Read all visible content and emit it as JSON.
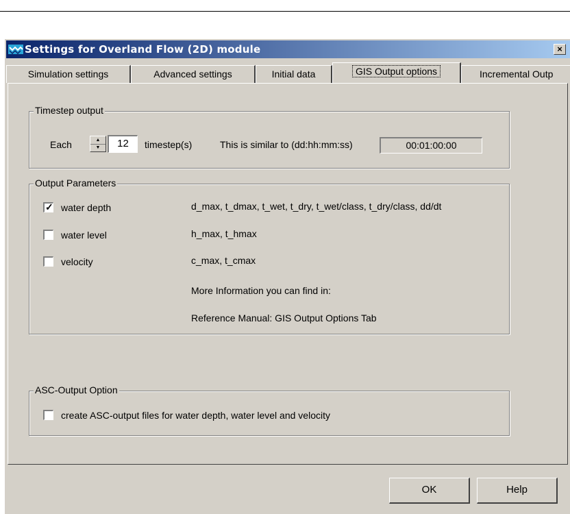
{
  "window": {
    "title": "Settings for Overland Flow (2D) module",
    "close_label": "×"
  },
  "tabs": [
    {
      "label": "Simulation settings"
    },
    {
      "label": "Advanced settings"
    },
    {
      "label": "Initial data"
    },
    {
      "label": "GIS Output options",
      "active": true
    },
    {
      "label": "Incremental Outp"
    }
  ],
  "timestep": {
    "group_title": "Timestep output",
    "each_label": "Each",
    "value": "12",
    "unit_label": "timestep(s)",
    "similar_label": "This is similar to (dd:hh:mm:ss)",
    "similar_value": "00:01:00:00"
  },
  "output_params": {
    "group_title": "Output Parameters",
    "items": [
      {
        "label": "water depth",
        "checked": true,
        "desc": "d_max, t_dmax, t_wet, t_dry, t_wet/class, t_dry/class, dd/dt"
      },
      {
        "label": "water level",
        "checked": false,
        "desc": "h_max, t_hmax"
      },
      {
        "label": "velocity",
        "checked": false,
        "desc": "c_max, t_cmax"
      }
    ],
    "info_line1": "More Information you can find in:",
    "info_line2": "Reference Manual: GIS Output Options Tab"
  },
  "asc": {
    "group_title": "ASC-Output Option",
    "checkbox_label": "create ASC-output files for water depth, water level and velocity",
    "checked": false
  },
  "buttons": {
    "ok": "OK",
    "help": "Help"
  },
  "colors": {
    "titlebar_start": "#0a246a",
    "titlebar_end": "#a6caf0",
    "face": "#d4d0c8"
  }
}
